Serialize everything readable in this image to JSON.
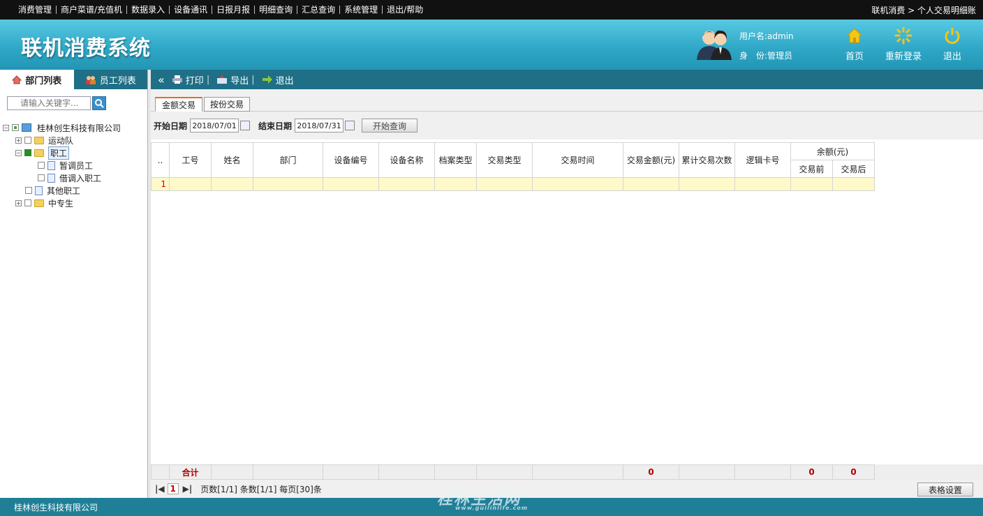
{
  "topmenu": {
    "items": [
      "消费管理",
      "商户菜谱/充值机",
      "数据录入",
      "设备通讯",
      "日报月报",
      "明细查询",
      "汇总查询",
      "系统管理",
      "退出/帮助"
    ],
    "crumb": "联机消费 > 个人交易明细账"
  },
  "header": {
    "title": "联机消费系统",
    "username": "用户名:admin",
    "role": "身　份:管理员",
    "btn_home": "首页",
    "btn_relogin": "重新登录",
    "btn_exit": "退出"
  },
  "sidebar": {
    "tab_dept": "部门列表",
    "tab_emp": "员工列表",
    "search_placeholder": "请输入关键字..."
  },
  "tree": {
    "root": "桂林创生科技有限公司",
    "n1": "运动队",
    "n2": "职工",
    "n2a": "暂调员工",
    "n2b": "借调入职工",
    "n3": "其他职工",
    "n4": "中专生"
  },
  "toolbar": {
    "collapse": "«",
    "print": "打印",
    "export": "导出",
    "exit": "退出",
    "sep": "|"
  },
  "subtabs": {
    "amount": "金额交易",
    "copies": "按份交易"
  },
  "filter": {
    "start_label": "开始日期",
    "start_value": "2018/07/01",
    "end_label": "结束日期",
    "end_value": "2018/07/31",
    "query_button": "开始查询"
  },
  "grid": {
    "headers": [
      "..",
      "工号",
      "姓名",
      "部门",
      "设备编号",
      "设备名称",
      "档案类型",
      "交易类型",
      "交易时间",
      "交易金额(元)",
      "累计交易次数",
      "逻辑卡号"
    ],
    "balance_group": "余额(元)",
    "balance_before": "交易前",
    "balance_after": "交易后",
    "row1_num": "1"
  },
  "totals": {
    "label": "合计",
    "amount": "0",
    "before": "0",
    "after": "0"
  },
  "pager": {
    "first": "|◀",
    "page": "1",
    "last": "▶|",
    "info": "页数[1/1] 条数[1/1] 每页[30]条",
    "settings": "表格设置"
  },
  "footer": {
    "company": "桂林创生科技有限公司"
  },
  "watermark": {
    "text": "桂林生活网",
    "url": "www.guilinlife.com"
  }
}
